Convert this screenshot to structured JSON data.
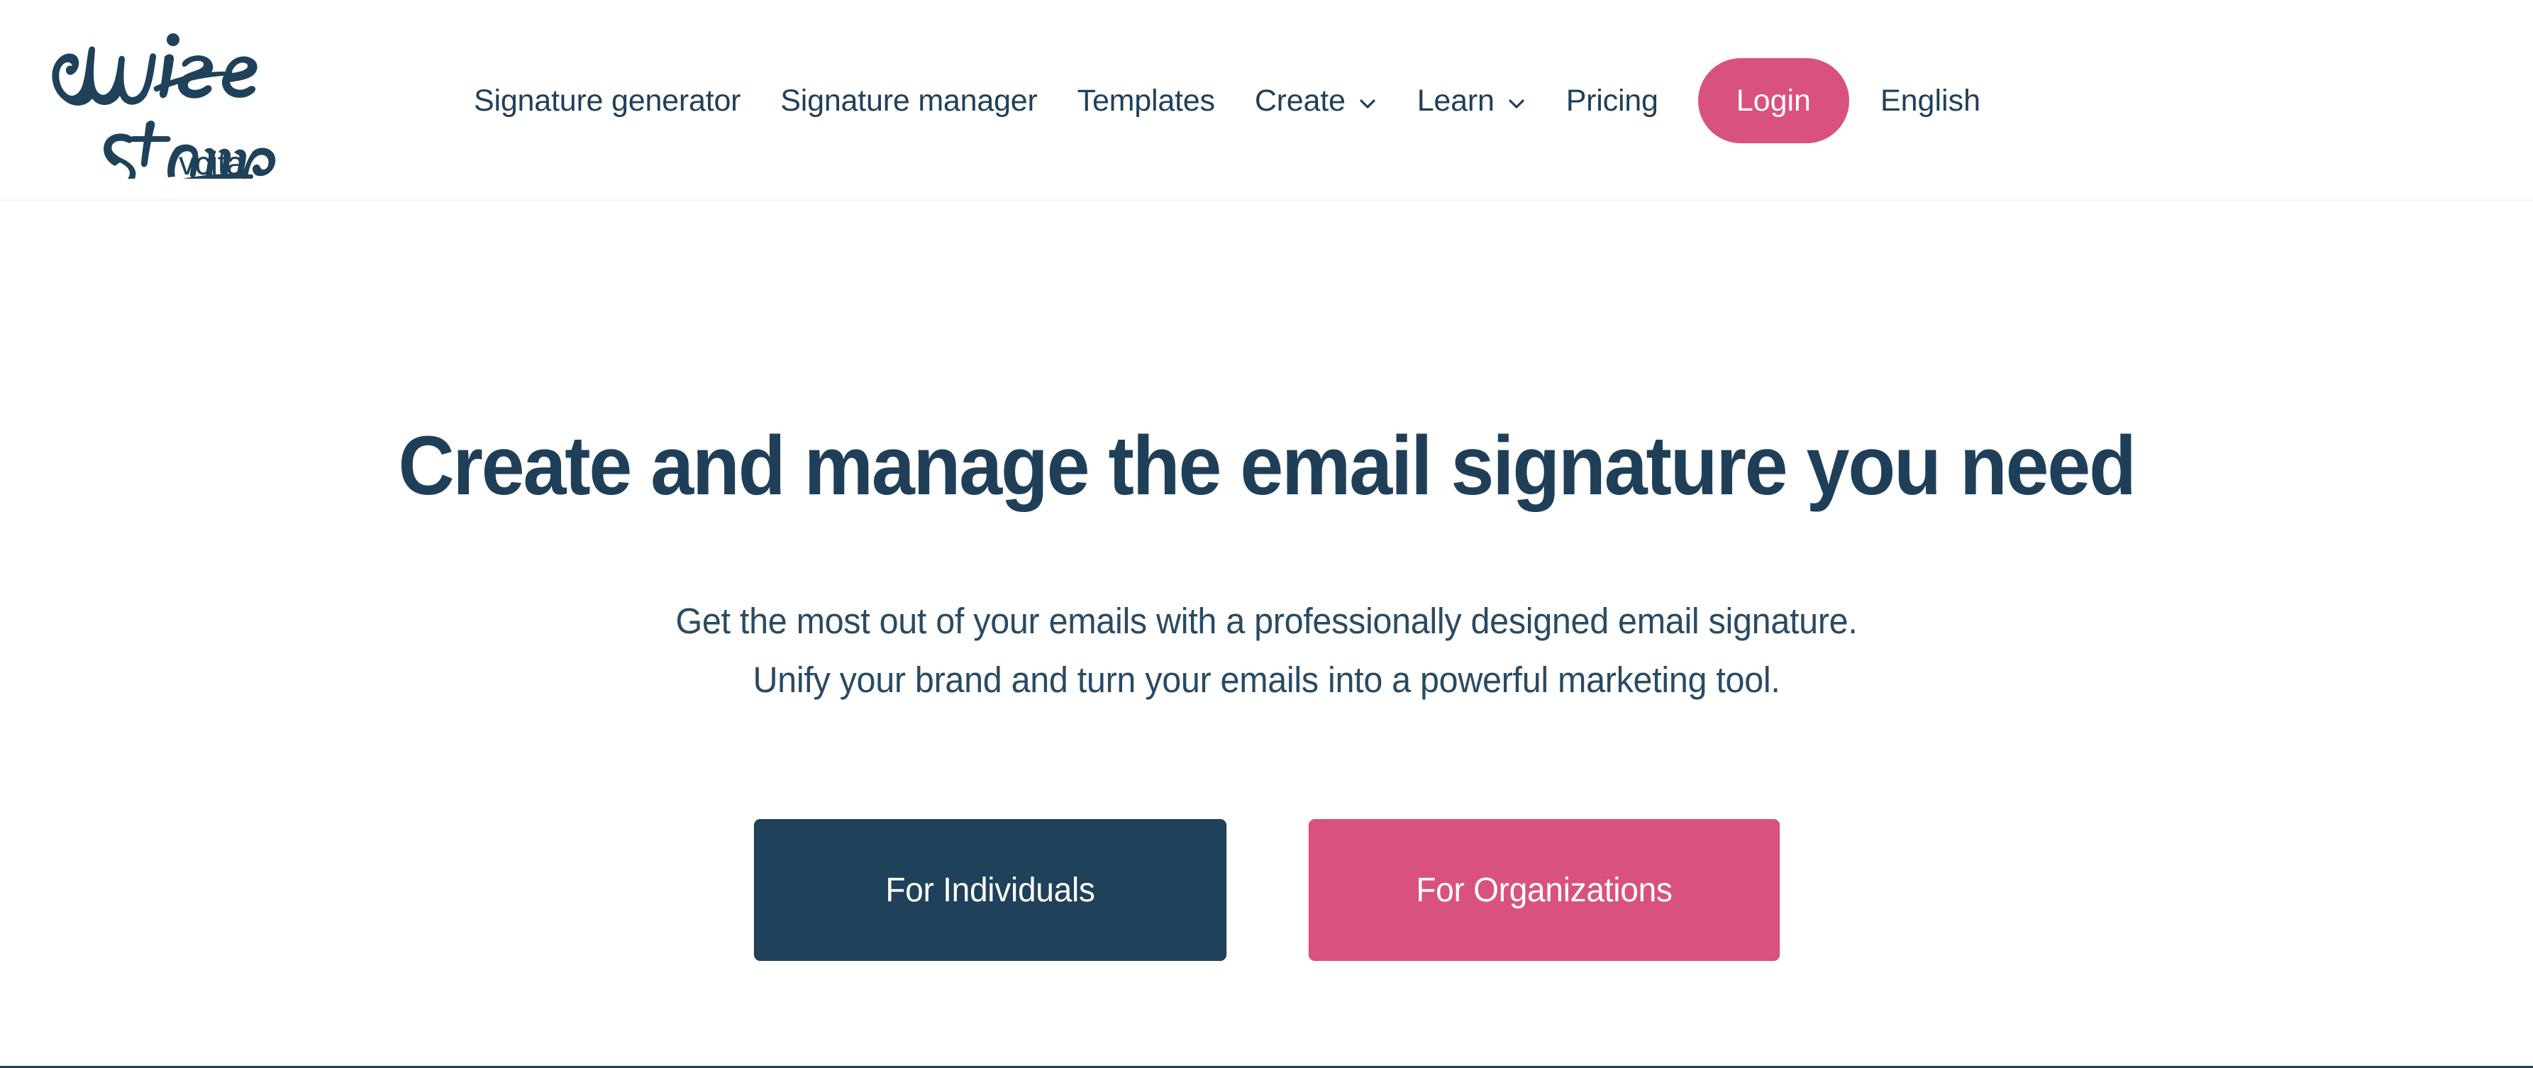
{
  "brand": {
    "logo_name": "WiseStamp",
    "logo_sub": "vcita",
    "navy": "#1f4159",
    "pink": "#d9517f"
  },
  "header": {
    "nav": [
      {
        "label": "Signature generator",
        "has_dropdown": false
      },
      {
        "label": "Signature manager",
        "has_dropdown": false
      },
      {
        "label": "Templates",
        "has_dropdown": false
      },
      {
        "label": "Create",
        "has_dropdown": true,
        "icon": "chevron-down-icon"
      },
      {
        "label": "Learn",
        "has_dropdown": true,
        "icon": "chevron-down-icon"
      },
      {
        "label": "Pricing",
        "has_dropdown": false
      }
    ],
    "login_label": "Login",
    "language_label": "English"
  },
  "hero": {
    "title": "Create and manage the email signature you need",
    "subtitle_line1": "Get the most out of your emails with a professionally designed email signature.",
    "subtitle_line2": "Unify your brand and turn your emails into a powerful marketing tool.",
    "cta_primary": "For Individuals",
    "cta_secondary": "For Organizations"
  }
}
